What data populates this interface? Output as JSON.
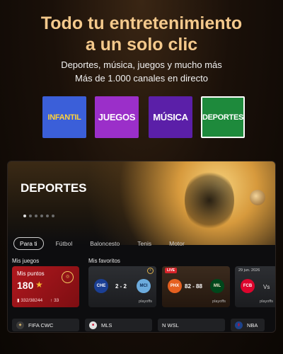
{
  "headline": {
    "line1": "Todo tu entretenimiento",
    "line2": "a un solo clic"
  },
  "subline": {
    "line1": "Deportes, música, juegos y mucho más",
    "line2": "Más de 1.000 canales en directo"
  },
  "categories": [
    {
      "label": "INFANTIL",
      "color": "#3b5fd9"
    },
    {
      "label": "JUEGOS",
      "color": "#9b2fc9"
    },
    {
      "label": "MÚSICA",
      "color": "#5b1fa8"
    },
    {
      "label": "DEPORTES",
      "color": "#1e8a3c"
    }
  ],
  "screen": {
    "hero_title": "DEPORTES",
    "carousel": {
      "count": 6,
      "active_index": 0
    },
    "tabs": [
      "Para ti",
      "Fútbol",
      "Baloncesto",
      "Tenis",
      "Motor"
    ],
    "active_tab": "Para ti",
    "sections": {
      "my_games": "Mis juegos",
      "my_favorites": "Mis favoritos"
    },
    "points_card": {
      "title": "Mis puntos",
      "value": "180",
      "progress": "332/38244",
      "extra": "33"
    },
    "matches": [
      {
        "live": "",
        "home": "CHE",
        "away": "MCI",
        "score": "2 - 2",
        "tag": "playoffs"
      },
      {
        "live": "LIVE",
        "home": "PHX",
        "away": "MIL",
        "score": "82 - 88",
        "tag": "playoffs"
      },
      {
        "live": "",
        "date": "29 jun. 2026",
        "home": "FCB",
        "vs": "Vs",
        "tag": "playoffs"
      }
    ],
    "leagues": [
      "FIFA CWC",
      "MLS",
      "N WSL",
      "NBA"
    ]
  },
  "colors": {
    "headline": "#f4c98c",
    "live": "#d8232a",
    "points_card": "#b0181e",
    "star": "#f5b92f"
  }
}
